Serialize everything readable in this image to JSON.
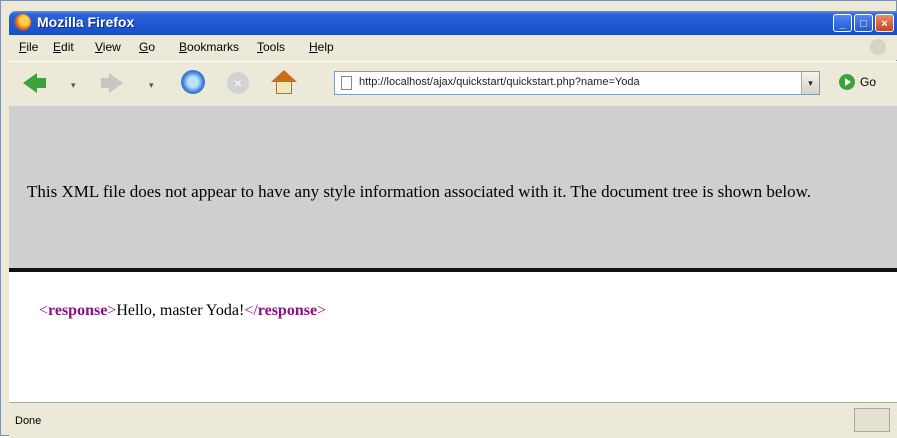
{
  "window": {
    "title": "Mozilla Firefox",
    "minimize": "_",
    "maximize": "□",
    "close": "×"
  },
  "menu": [
    "File",
    "Edit",
    "View",
    "Go",
    "Bookmarks",
    "Tools",
    "Help"
  ],
  "toolbar": {
    "url": "http://localhost/ajax/quickstart/quickstart.php?name=Yoda",
    "go_label": "Go",
    "dropdown": "▾"
  },
  "xml_notice": "This XML file does not appear to have any style information associated with it. The document tree is shown below.",
  "xml": {
    "open_bracket": "<",
    "tag": "response",
    "close_bracket": ">",
    "text": "Hello, master Yoda!",
    "end_open": "</"
  },
  "status": {
    "text": "Done"
  },
  "icons": [
    "firefox-logo",
    "back-arrow",
    "forward-arrow",
    "reload",
    "stop",
    "home",
    "page",
    "go-arrow"
  ]
}
